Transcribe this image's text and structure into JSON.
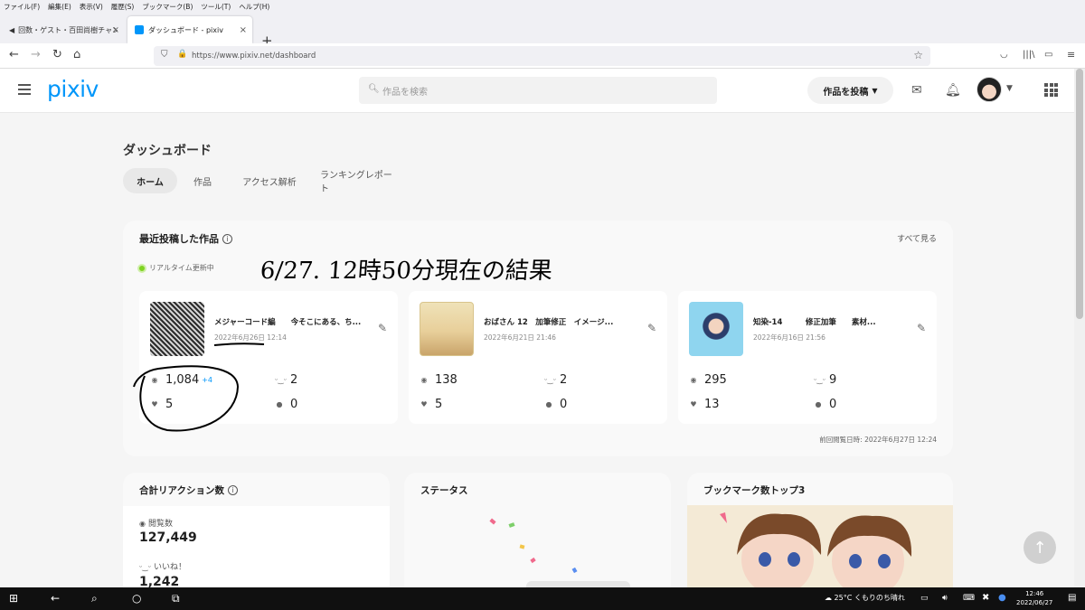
{
  "browser": {
    "menu": [
      "ファイル(F)",
      "編集(E)",
      "表示(V)",
      "履歴(S)",
      "ブックマーク(B)",
      "ツール(T)",
      "ヘルプ(H)"
    ],
    "tabs": [
      {
        "title": "回数・ゲスト・百田尚樹チャンネル生..."
      },
      {
        "title": "ダッシュボード - pixiv"
      }
    ],
    "url": "https://www.pixiv.net/dashboard"
  },
  "header": {
    "logo": "pixiv",
    "search_placeholder": "作品を検索",
    "post_button": "作品を投稿"
  },
  "dashboard": {
    "title": "ダッシュボード",
    "tabs": [
      "ホーム",
      "作品",
      "アクセス解析",
      "ランキングレポート"
    ]
  },
  "recent": {
    "title": "最近投稿した作品",
    "see_all": "すべて見る",
    "realtime": "リアルタイム更新中",
    "handwritten_note": "6/27. 12時50分現在の結果",
    "last_viewed": "前回閲覧日時: 2022年6月27日 12:24",
    "works": [
      {
        "title": "メジャーコード編　　今そこにある、ち...",
        "date": "2022年6月26日 12:14",
        "views": "1,084",
        "views_delta": "+4",
        "likes": "2",
        "bookmarks": "5",
        "comments": "0"
      },
      {
        "title": "おばさん 12　加筆修正　イメージ...",
        "date": "2022年6月21日 21:46",
        "views": "138",
        "views_delta": "",
        "likes": "2",
        "bookmarks": "5",
        "comments": "0"
      },
      {
        "title": "知染-14　　　修正加筆　　素材...",
        "date": "2022年6月16日 21:56",
        "views": "295",
        "views_delta": "",
        "likes": "9",
        "bookmarks": "13",
        "comments": "0"
      }
    ]
  },
  "total": {
    "title": "合計リアクション数",
    "views_label": "閲覧数",
    "views_value": "127,449",
    "likes_label": "いいね！",
    "likes_value": "1,242"
  },
  "status": {
    "title": "ステータス"
  },
  "bookmark_top": {
    "title": "ブックマーク数トップ3"
  },
  "taskbar": {
    "weather": "25°C くもりのち晴れ",
    "time": "12:46",
    "date": "2022/06/27"
  }
}
